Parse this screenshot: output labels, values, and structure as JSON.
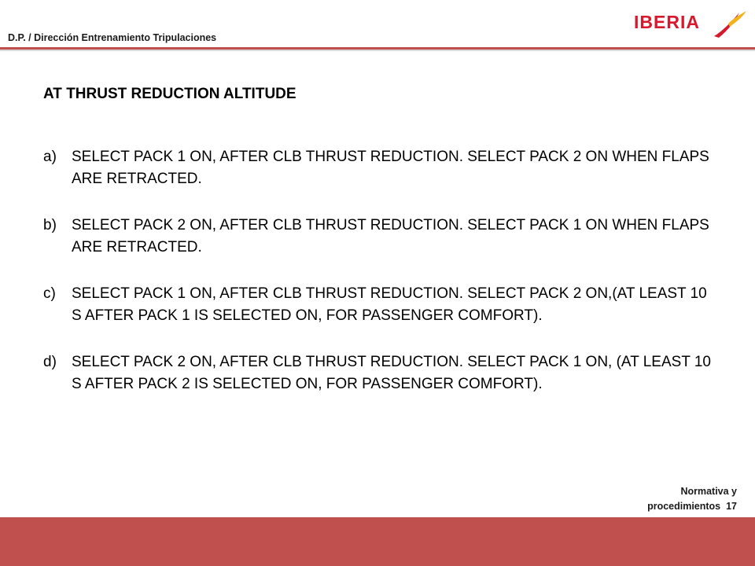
{
  "header": {
    "department": "D.P. / Dirección Entrenamiento Tripulaciones",
    "logo_text": "IBERIA",
    "accent_color": "#c0504d",
    "brand_color": "#d7192d"
  },
  "question": {
    "title": "AT THRUST REDUCTION ALTITUDE",
    "options": [
      {
        "letter": "a)",
        "text": "SELECT PACK 1 ON, AFTER CLB THRUST REDUCTION. SELECT PACK 2 ON WHEN FLAPS ARE RETRACTED."
      },
      {
        "letter": "b)",
        "text": "SELECT PACK 2 ON, AFTER CLB THRUST REDUCTION. SELECT PACK 1 ON WHEN FLAPS ARE RETRACTED."
      },
      {
        "letter": "c)",
        "text": "SELECT PACK 1 ON, AFTER CLB THRUST REDUCTION. SELECT PACK 2 ON,(AT LEAST 10 S AFTER PACK 1 IS SELECTED ON, FOR PASSENGER COMFORT)."
      },
      {
        "letter": "d)",
        "text": "SELECT PACK 2 ON, AFTER CLB THRUST REDUCTION. SELECT PACK 1 ON, (AT LEAST 10 S AFTER PACK 2 IS SELECTED ON, FOR PASSENGER COMFORT)."
      }
    ]
  },
  "footer": {
    "line1": "Normativa y",
    "line2": "procedimientos  17"
  }
}
